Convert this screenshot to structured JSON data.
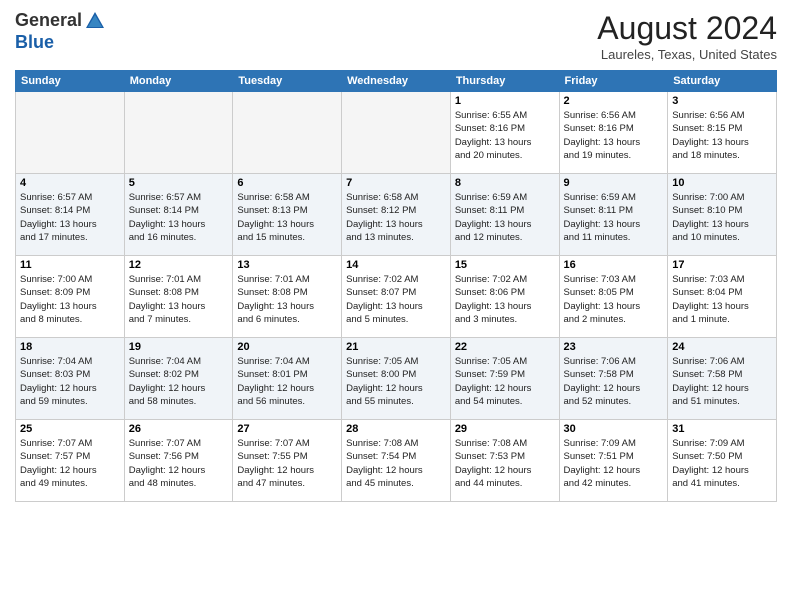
{
  "header": {
    "logo_general": "General",
    "logo_blue": "Blue",
    "month_title": "August 2024",
    "location": "Laureles, Texas, United States"
  },
  "weekdays": [
    "Sunday",
    "Monday",
    "Tuesday",
    "Wednesday",
    "Thursday",
    "Friday",
    "Saturday"
  ],
  "weeks": [
    [
      {
        "day": "",
        "detail": ""
      },
      {
        "day": "",
        "detail": ""
      },
      {
        "day": "",
        "detail": ""
      },
      {
        "day": "",
        "detail": ""
      },
      {
        "day": "1",
        "detail": "Sunrise: 6:55 AM\nSunset: 8:16 PM\nDaylight: 13 hours\nand 20 minutes."
      },
      {
        "day": "2",
        "detail": "Sunrise: 6:56 AM\nSunset: 8:16 PM\nDaylight: 13 hours\nand 19 minutes."
      },
      {
        "day": "3",
        "detail": "Sunrise: 6:56 AM\nSunset: 8:15 PM\nDaylight: 13 hours\nand 18 minutes."
      }
    ],
    [
      {
        "day": "4",
        "detail": "Sunrise: 6:57 AM\nSunset: 8:14 PM\nDaylight: 13 hours\nand 17 minutes."
      },
      {
        "day": "5",
        "detail": "Sunrise: 6:57 AM\nSunset: 8:14 PM\nDaylight: 13 hours\nand 16 minutes."
      },
      {
        "day": "6",
        "detail": "Sunrise: 6:58 AM\nSunset: 8:13 PM\nDaylight: 13 hours\nand 15 minutes."
      },
      {
        "day": "7",
        "detail": "Sunrise: 6:58 AM\nSunset: 8:12 PM\nDaylight: 13 hours\nand 13 minutes."
      },
      {
        "day": "8",
        "detail": "Sunrise: 6:59 AM\nSunset: 8:11 PM\nDaylight: 13 hours\nand 12 minutes."
      },
      {
        "day": "9",
        "detail": "Sunrise: 6:59 AM\nSunset: 8:11 PM\nDaylight: 13 hours\nand 11 minutes."
      },
      {
        "day": "10",
        "detail": "Sunrise: 7:00 AM\nSunset: 8:10 PM\nDaylight: 13 hours\nand 10 minutes."
      }
    ],
    [
      {
        "day": "11",
        "detail": "Sunrise: 7:00 AM\nSunset: 8:09 PM\nDaylight: 13 hours\nand 8 minutes."
      },
      {
        "day": "12",
        "detail": "Sunrise: 7:01 AM\nSunset: 8:08 PM\nDaylight: 13 hours\nand 7 minutes."
      },
      {
        "day": "13",
        "detail": "Sunrise: 7:01 AM\nSunset: 8:08 PM\nDaylight: 13 hours\nand 6 minutes."
      },
      {
        "day": "14",
        "detail": "Sunrise: 7:02 AM\nSunset: 8:07 PM\nDaylight: 13 hours\nand 5 minutes."
      },
      {
        "day": "15",
        "detail": "Sunrise: 7:02 AM\nSunset: 8:06 PM\nDaylight: 13 hours\nand 3 minutes."
      },
      {
        "day": "16",
        "detail": "Sunrise: 7:03 AM\nSunset: 8:05 PM\nDaylight: 13 hours\nand 2 minutes."
      },
      {
        "day": "17",
        "detail": "Sunrise: 7:03 AM\nSunset: 8:04 PM\nDaylight: 13 hours\nand 1 minute."
      }
    ],
    [
      {
        "day": "18",
        "detail": "Sunrise: 7:04 AM\nSunset: 8:03 PM\nDaylight: 12 hours\nand 59 minutes."
      },
      {
        "day": "19",
        "detail": "Sunrise: 7:04 AM\nSunset: 8:02 PM\nDaylight: 12 hours\nand 58 minutes."
      },
      {
        "day": "20",
        "detail": "Sunrise: 7:04 AM\nSunset: 8:01 PM\nDaylight: 12 hours\nand 56 minutes."
      },
      {
        "day": "21",
        "detail": "Sunrise: 7:05 AM\nSunset: 8:00 PM\nDaylight: 12 hours\nand 55 minutes."
      },
      {
        "day": "22",
        "detail": "Sunrise: 7:05 AM\nSunset: 7:59 PM\nDaylight: 12 hours\nand 54 minutes."
      },
      {
        "day": "23",
        "detail": "Sunrise: 7:06 AM\nSunset: 7:58 PM\nDaylight: 12 hours\nand 52 minutes."
      },
      {
        "day": "24",
        "detail": "Sunrise: 7:06 AM\nSunset: 7:58 PM\nDaylight: 12 hours\nand 51 minutes."
      }
    ],
    [
      {
        "day": "25",
        "detail": "Sunrise: 7:07 AM\nSunset: 7:57 PM\nDaylight: 12 hours\nand 49 minutes."
      },
      {
        "day": "26",
        "detail": "Sunrise: 7:07 AM\nSunset: 7:56 PM\nDaylight: 12 hours\nand 48 minutes."
      },
      {
        "day": "27",
        "detail": "Sunrise: 7:07 AM\nSunset: 7:55 PM\nDaylight: 12 hours\nand 47 minutes."
      },
      {
        "day": "28",
        "detail": "Sunrise: 7:08 AM\nSunset: 7:54 PM\nDaylight: 12 hours\nand 45 minutes."
      },
      {
        "day": "29",
        "detail": "Sunrise: 7:08 AM\nSunset: 7:53 PM\nDaylight: 12 hours\nand 44 minutes."
      },
      {
        "day": "30",
        "detail": "Sunrise: 7:09 AM\nSunset: 7:51 PM\nDaylight: 12 hours\nand 42 minutes."
      },
      {
        "day": "31",
        "detail": "Sunrise: 7:09 AM\nSunset: 7:50 PM\nDaylight: 12 hours\nand 41 minutes."
      }
    ]
  ]
}
